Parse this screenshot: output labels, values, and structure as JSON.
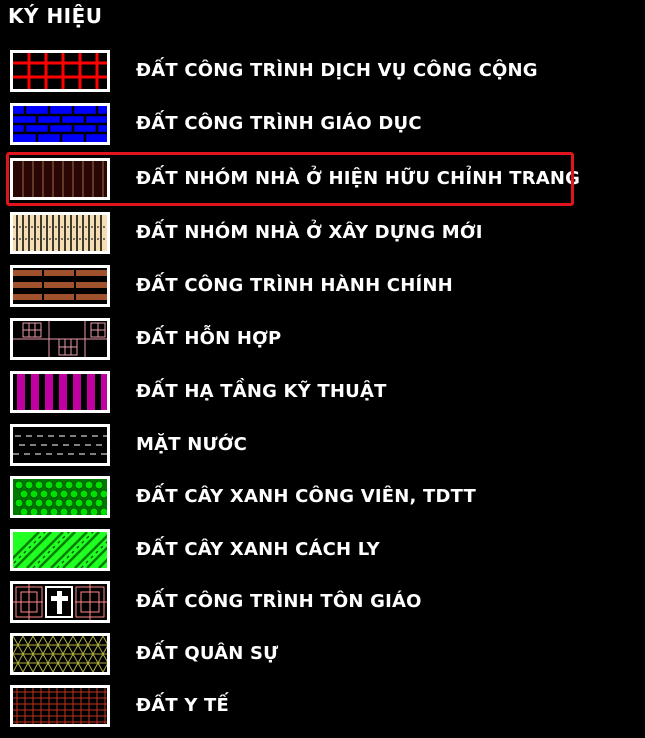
{
  "legend": {
    "title": "KÝ HIỆU",
    "items": [
      {
        "label": "ĐẤT CÔNG TRÌNH DỊCH VỤ CÔNG CỘNG",
        "icon": "red-grid-pattern-icon",
        "color": "#ff0000"
      },
      {
        "label": "ĐẤT CÔNG TRÌNH GIÁO DỤC",
        "icon": "blue-brick-pattern-icon",
        "color": "#0000ff"
      },
      {
        "label": "ĐẤT NHÓM NHÀ Ở HIỆN HỮU CHỈNH TRANG",
        "icon": "dark-brown-vertical-lines-icon",
        "color": "#3a0a06",
        "highlighted": true
      },
      {
        "label": "ĐẤT NHÓM NHÀ Ở XÂY DỰNG MỚI",
        "icon": "beige-vertical-stripes-icon",
        "color": "#f5deb3"
      },
      {
        "label": "ĐẤT CÔNG TRÌNH HÀNH CHÍNH",
        "icon": "brown-horizontal-stripes-icon",
        "color": "#a0522d"
      },
      {
        "label": "ĐẤT HỖN HỢP",
        "icon": "pink-mixed-grid-icon",
        "color": "#e89aa8"
      },
      {
        "label": "ĐẤT HẠ TẦNG KỸ THUẬT",
        "icon": "magenta-vertical-stripes-icon",
        "color": "#c000a0"
      },
      {
        "label": "MẶT NƯỚC",
        "icon": "dashed-water-icon",
        "color": "#ffffff"
      },
      {
        "label": "ĐẤT CÂY XANH CÔNG VIÊN, TDTT",
        "icon": "green-circles-pattern-icon",
        "color": "#00e000"
      },
      {
        "label": "ĐẤT CÂY XANH CÁCH LY",
        "icon": "green-diagonal-hatch-icon",
        "color": "#00ff00"
      },
      {
        "label": "ĐẤT CÔNG TRÌNH TÔN GIÁO",
        "icon": "cross-religious-icon",
        "color": "#ffffff"
      },
      {
        "label": "ĐẤT QUÂN SỰ",
        "icon": "olive-triangle-pattern-icon",
        "color": "#b0b040"
      },
      {
        "label": "ĐẤT Y TẾ",
        "icon": "red-fine-grid-icon",
        "color": "#c03020"
      }
    ]
  }
}
